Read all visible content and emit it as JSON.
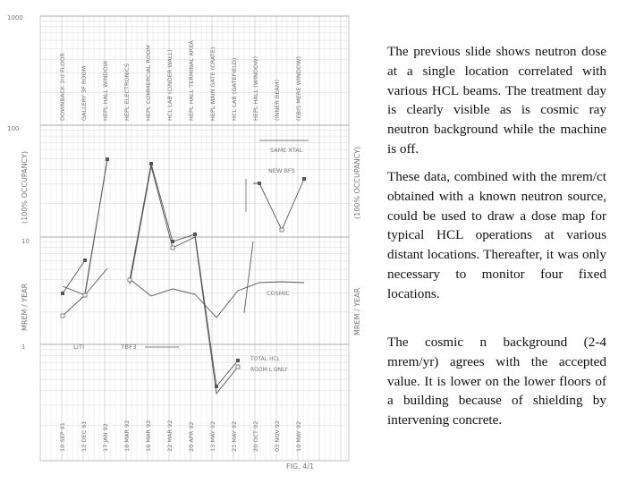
{
  "slide": {
    "paragraphs": [
      "The previous slide shows neutron dose at a single location correlated with various HCL beams. The treatment day is clearly visible as is cosmic ray neutron background while the machine is off.",
      "These data, combined with the mrem/ct obtained with a known neutron source, could be used to draw a dose map for typical HCL operations at various distant locations. Thereafter, it was only necessary to monitor four fixed locations.",
      "The cosmic n background (2-4 mrem/yr) agrees with the accepted value. It is lower on the lower floors of a building because of shielding by intervening concrete."
    ]
  },
  "figure": {
    "caption": "FIG. 4/1",
    "left_axis_label": "MREM / YEAR",
    "left_axis_label_upper": "(100% OCCUPANCY)",
    "right_axis_label": "MREM / YEAR",
    "right_axis_label_upper": "(100% OCCUPANCY)",
    "y_ticks": [
      "1000",
      "100",
      "10",
      "1"
    ],
    "beam_labels": [
      "DOWNBACK 3rd FLOOR",
      "GALLERY 3F ROOM",
      "HEPL HALL WINDOW",
      "HEPL ELECTRONICS",
      "HEPL COMMERCIAL ROOM",
      "HCL LAB (CINDER WALL)",
      "HEPL HALL TERMINAL AREA",
      "HEPL MAIN GATE (CRATE)",
      "HCL LAB (GATEFIELD)",
      "HEPL HALL (WINDOW)",
      "(INNER BEAM)",
      "(EBIS MERE WINDOW)"
    ],
    "date_labels": [
      "10 SEP 91",
      "12 DEC 91",
      "17 JAN 92",
      "18 MAR 92",
      "16 MAR 92",
      "22 MAR 92",
      "20 APR 92",
      "13 MAY 92",
      "21 MAY 92",
      "20 OCT 92",
      "03 NOV 92",
      "10 MAY 92"
    ],
    "annotations": {
      "new_bfs": "NEW BFS",
      "same_xtal": "SAME XTAL",
      "cosmic": "COSMIC",
      "liti": "LiTI",
      "tbf": "TBF3",
      "total_hcl": "TOTAL HCL",
      "room_only": "ROOM L ONLY"
    },
    "colors": {
      "ink": "#555555",
      "grid": "#cfcfcf"
    }
  }
}
